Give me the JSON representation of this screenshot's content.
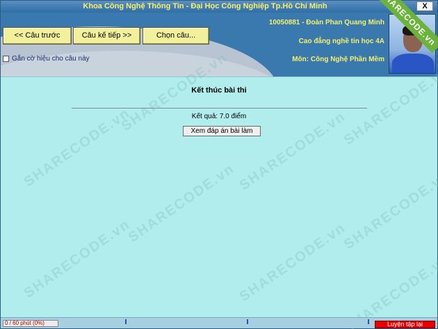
{
  "window": {
    "title": "Khoa Công Nghệ Thông Tin - Đại Học Công Nghiệp Tp.Hồ Chí Minh",
    "close_label": "X"
  },
  "toolbar": {
    "prev_label": "<< Câu trước",
    "next_label": "Câu kế tiếp >>",
    "choose_label": "Chọn câu..."
  },
  "flag": {
    "label": "Gắn cờ hiệu cho câu này",
    "checked": false
  },
  "student": {
    "id_name": "10050881 - Đoàn Phan Quang Minh",
    "class": "Cao đẳng nghề tin học 4A",
    "subject": "Môn: Công Nghệ Phần Mềm"
  },
  "watermark": {
    "ribbon_text": "SHARECODE.vn",
    "text": "SHARECODE.vn",
    "color": "#8fd0d0"
  },
  "exam": {
    "end_title": "Kết thúc bài thi",
    "result": "Kết quả: 7.0 điểm",
    "review_label": "Xem đáp án bài làm"
  },
  "status": {
    "timer": "0 / 60 phút (0%)",
    "timer_progress_fraction": 0.0,
    "practice_label": "Luyện tập lại"
  },
  "colors": {
    "header_bg": "#3a79ad",
    "title_text": "#f6f06a",
    "content_bg": "#b2eded",
    "nav_button": "#f3f09b",
    "practice_button": "#e80000"
  }
}
